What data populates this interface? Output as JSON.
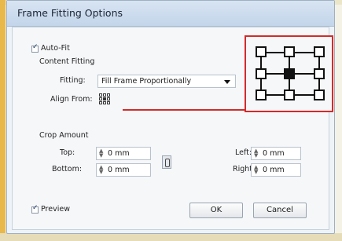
{
  "window": {
    "title": "Frame Fitting Options"
  },
  "auto_fit": {
    "label": "Auto-Fit",
    "checked": true
  },
  "content_fitting": {
    "heading": "Content Fitting",
    "fitting_label": "Fitting:",
    "fitting_value": "Fill Frame Proportionally",
    "align_from_label": "Align From:"
  },
  "crop_amount": {
    "heading": "Crop Amount",
    "top_label": "Top:",
    "top_value": "0 mm",
    "bottom_label": "Bottom:",
    "bottom_value": "0 mm",
    "left_label": "Left:",
    "left_value": "0 mm",
    "right_label": "Right:",
    "right_value": "0 mm"
  },
  "preview": {
    "label": "Preview",
    "checked": true
  },
  "buttons": {
    "ok": "OK",
    "cancel": "Cancel"
  },
  "colors": {
    "highlight": "#d42a2a",
    "titlebar": "#c9d9ec"
  },
  "icons": [
    "checkmark-icon",
    "dropdown-arrow-icon",
    "reference-point-icon",
    "spinner-icon",
    "chain-link-icon"
  ]
}
